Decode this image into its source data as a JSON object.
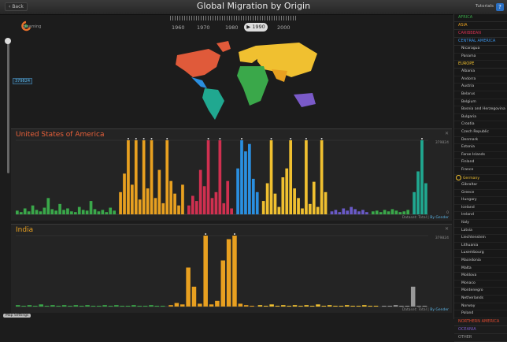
{
  "header": {
    "back_label": "Back",
    "title": "Global Migration by Origin",
    "tutorials_label": "Tutorials",
    "help_label": "?"
  },
  "logo": {
    "text": "gleaming"
  },
  "timeline": {
    "years": [
      "1960",
      "1970",
      "1980",
      "1990",
      "2000"
    ],
    "selected": "1990"
  },
  "slider": {
    "value": "379824"
  },
  "panels": [
    {
      "title": "United States of America",
      "max_label": "379824",
      "zero_label": "0",
      "dataset_label": "Dataset:",
      "dataset_total": "Total",
      "dataset_gender": "By Gender"
    },
    {
      "title": "India",
      "max_label": "379824",
      "zero_label": "0",
      "dataset_label": "Dataset:",
      "dataset_total": "Total",
      "dataset_gender": "By Gender"
    }
  ],
  "sidebar": {
    "regions_top": [
      {
        "label": "AFRICA",
        "color": "#3aa84a"
      },
      {
        "label": "ASIA",
        "color": "#e8a020"
      },
      {
        "label": "CARIBBEAN",
        "color": "#d03050"
      },
      {
        "label": "CENTRAL AMERICA",
        "color": "#3a8fe0"
      }
    ],
    "central_america": [
      "Nicaragua",
      "Panama"
    ],
    "europe_label": "EUROPE",
    "europe_color": "#f0c030",
    "europe": [
      "Albania",
      "Andorra",
      "Austria",
      "Belarus",
      "Belgium",
      "Bosnia and Herzegovina",
      "Bulgaria",
      "Croatia",
      "Czech Republic",
      "Denmark",
      "Estonia",
      "Faroe Islands",
      "Finland",
      "France",
      "Germany",
      "Gibraltar",
      "Greece",
      "Hungary",
      "Iceland",
      "Ireland",
      "Italy",
      "Latvia",
      "Liechtenstein",
      "Lithuania",
      "Luxembourg",
      "Macedonia",
      "Malta",
      "Moldova",
      "Monaco",
      "Montenegro",
      "Netherlands",
      "Norway",
      "Poland"
    ],
    "selected_country": "Germany",
    "regions_bottom": [
      {
        "label": "NORTHERN AMERICA",
        "color": "#e04a30"
      },
      {
        "label": "OCEANIA",
        "color": "#7a5ac8"
      },
      {
        "label": "OTHER",
        "color": "#999999"
      }
    ]
  },
  "bottom_button": "Map Settings",
  "colors": {
    "africa": "#3aa84a",
    "asia": "#e8a020",
    "caribbean": "#d03050",
    "central_america": "#2a8fe0",
    "europe": "#f0c030",
    "oceania": "#20a890",
    "other": "#999999"
  },
  "chart_data": [
    {
      "type": "bar",
      "title": "United States of America",
      "ylim": [
        0,
        379824
      ],
      "segments": [
        {
          "region": "africa",
          "values": [
            5,
            3,
            8,
            4,
            12,
            6,
            4,
            9,
            22,
            7,
            5,
            14,
            6,
            8,
            4,
            3,
            10,
            6,
            5,
            18,
            7,
            4,
            6,
            3,
            9,
            5
          ]
        },
        {
          "region": "asia",
          "values": [
            30,
            55,
            100,
            40,
            100,
            20,
            100,
            35,
            100,
            22,
            60,
            15,
            100,
            45,
            28,
            12,
            40
          ]
        },
        {
          "region": "caribbean",
          "values": [
            12,
            25,
            18,
            60,
            38,
            100,
            22,
            30,
            100,
            15,
            45,
            8
          ]
        },
        {
          "region": "central_america",
          "values": [
            62,
            100,
            85,
            95,
            48,
            30
          ]
        },
        {
          "region": "europe",
          "values": [
            18,
            42,
            100,
            28,
            10,
            50,
            62,
            100,
            35,
            22,
            8,
            100,
            14,
            44,
            10,
            100,
            30
          ]
        },
        {
          "region": "oceania",
          "values": [
            4,
            6,
            3,
            8,
            5,
            10,
            7,
            4,
            6,
            3
          ]
        },
        {
          "region": "africa_tail",
          "values": [
            4,
            5,
            3,
            6,
            4,
            7,
            5,
            3,
            4,
            6
          ]
        },
        {
          "region": "oceania_teal",
          "values": [
            30,
            58,
            100,
            42
          ]
        }
      ]
    },
    {
      "type": "bar",
      "title": "India",
      "ylim": [
        0,
        379824
      ],
      "segments": [
        {
          "region": "africa",
          "values": [
            2,
            1,
            2,
            1,
            3,
            1,
            2,
            1,
            2,
            1,
            2,
            1,
            2,
            1,
            1,
            2,
            1,
            2,
            1,
            1,
            2,
            1,
            1,
            2,
            1,
            1
          ]
        },
        {
          "region": "asia",
          "values": [
            2,
            5,
            3,
            55,
            28,
            4,
            100,
            3,
            8,
            65,
            95,
            100,
            4,
            2,
            1
          ]
        },
        {
          "region": "europe",
          "values": [
            2,
            1,
            3,
            1,
            2,
            1,
            2,
            1,
            2,
            1,
            3,
            1,
            2,
            1,
            1,
            2,
            1,
            1,
            2,
            1,
            1
          ]
        },
        {
          "region": "other",
          "values": [
            1,
            1,
            2,
            1,
            1,
            28,
            1,
            1
          ]
        }
      ]
    }
  ]
}
